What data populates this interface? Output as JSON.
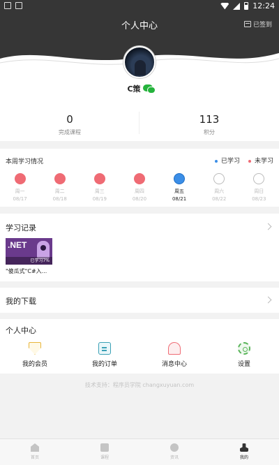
{
  "status_bar": {
    "time": "12:24"
  },
  "header": {
    "title": "个人中心",
    "signin_label": "已签到"
  },
  "profile": {
    "username": "C策"
  },
  "stats": [
    {
      "value": "0",
      "label": "完成课程"
    },
    {
      "value": "113",
      "label": "积分"
    }
  ],
  "weekly": {
    "title": "本周学习情况",
    "legend_learned": "已学习",
    "legend_not_learned": "未学习",
    "legend_colors": {
      "learned": "#3b8ee7",
      "not_learned": "#ef6b74"
    },
    "days": [
      {
        "name": "周一",
        "date": "08/17",
        "state": "missed"
      },
      {
        "name": "周二",
        "date": "08/18",
        "state": "missed"
      },
      {
        "name": "周三",
        "date": "08/19",
        "state": "missed"
      },
      {
        "name": "周四",
        "date": "08/20",
        "state": "missed"
      },
      {
        "name": "周五",
        "date": "08/21",
        "state": "today"
      },
      {
        "name": "周六",
        "date": "08/22",
        "state": "future"
      },
      {
        "name": "周日",
        "date": "08/23",
        "state": "future"
      }
    ]
  },
  "records": {
    "title": "学习记录",
    "course_thumb_text": ".NET",
    "course_progress": "已学习7%",
    "course_name": "\"傻瓜式\"C#入..."
  },
  "downloads": {
    "title": "我的下载"
  },
  "personal_center": {
    "title": "个人中心",
    "items": [
      {
        "label": "我的会员",
        "icon": "member-icon"
      },
      {
        "label": "我的订单",
        "icon": "order-icon"
      },
      {
        "label": "消息中心",
        "icon": "bell-icon"
      },
      {
        "label": "设置",
        "icon": "gear-icon"
      }
    ]
  },
  "support_text": "技术支持：程序员学院 changxuyuan.com",
  "tabbar": {
    "items": [
      {
        "label": "首页",
        "icon": "home-icon",
        "active": false
      },
      {
        "label": "课程",
        "icon": "course-icon",
        "active": false
      },
      {
        "label": "资讯",
        "icon": "compass-icon",
        "active": false
      },
      {
        "label": "我的",
        "icon": "user-icon",
        "active": true
      }
    ]
  }
}
